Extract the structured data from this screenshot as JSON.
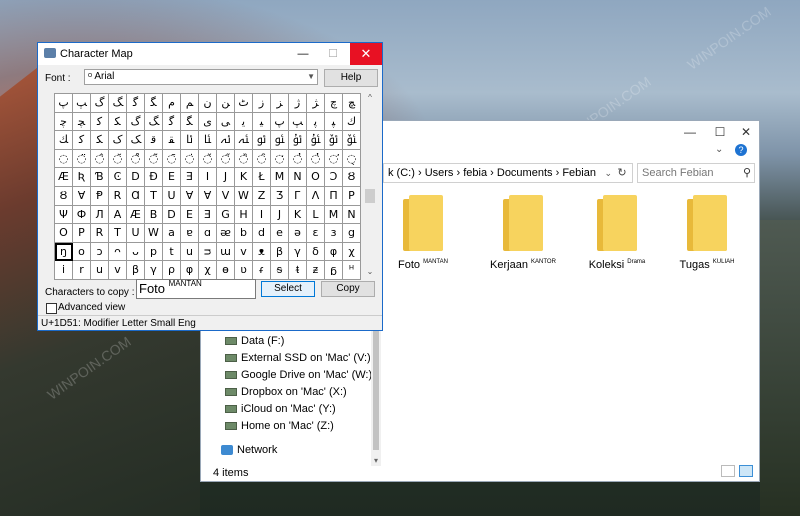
{
  "desktop": {
    "watermark": "WINPOIN.COM"
  },
  "explorer": {
    "address": {
      "segments": [
        "k (C:)",
        "Users",
        "febia",
        "Documents",
        "Febian"
      ],
      "separator": "›",
      "dropdown_icon": "chevron-down-icon",
      "refresh_icon": "refresh-icon"
    },
    "search_placeholder": "Search Febian",
    "window_buttons": [
      "—",
      "☐",
      "✕"
    ],
    "folders": [
      {
        "name": "Foto",
        "tag": "MANTAN"
      },
      {
        "name": "Kerjaan",
        "tag": "KANTOR"
      },
      {
        "name": "Koleksi",
        "tag": "Drama"
      },
      {
        "name": "Tugas",
        "tag": "KULIAH"
      }
    ],
    "nav_items": [
      {
        "label": "Data (F:)",
        "icon": "drive-icon"
      },
      {
        "label": "External SSD on 'Mac' (V:)",
        "icon": "drive-icon"
      },
      {
        "label": "Google Drive on 'Mac' (W:)",
        "icon": "drive-icon"
      },
      {
        "label": "Dropbox on 'Mac' (X:)",
        "icon": "drive-icon"
      },
      {
        "label": "iCloud on 'Mac' (Y:)",
        "icon": "drive-icon"
      },
      {
        "label": "Home on 'Mac' (Z:)",
        "icon": "drive-icon"
      }
    ],
    "network_label": "Network",
    "status": "4 items"
  },
  "charmap": {
    "title": "Character Map",
    "font_label": "Font :",
    "font_value": "Arial",
    "help_label": "Help",
    "grid_rows": [
      [
        "ﭖ",
        "ﭗ",
        "ﮒ",
        "ﮓ",
        "ﮔ",
        "ﮕ",
        "ﻡ",
        "ﻢ",
        "ﻥ",
        "ﻦ",
        "ﭦ",
        "ﺯ",
        "ﺰ",
        "ﮊ",
        "ﮋ",
        "ﭺ",
        "ﭻ"
      ],
      [
        "ﭼ",
        "ﭽ",
        "ﮐ",
        "ﮑ",
        "ﮒ",
        "ﮓ",
        "ﮔ",
        "ﮕ",
        "ﯼ",
        "ﯽ",
        "ﯾ",
        "ﯿ",
        "ﭖ",
        "ﭗ",
        "ﭘ",
        "ﭙ",
        "ﻙ"
      ],
      [
        "ﻚ",
        "ﻛ",
        "ﻜ",
        "ﮎ",
        "ﮏ",
        "ﻗ",
        "ﻘ",
        "ﯪ",
        "ﯫ",
        "ﯬ",
        "ﯭ",
        "ﯮ",
        "ﯯ",
        "ﯰ",
        "ﯱ",
        "ﯲ",
        "ﯳ"
      ],
      [
        "◌",
        "◌̈",
        "◌̂",
        "◌̆",
        "◌̊",
        "◌̃",
        "◌̄",
        "◌̇",
        "◌̌",
        "◌̋",
        "◌̏",
        "◌̑",
        "◌̒",
        "◌̓",
        "◌̔",
        "◌̕",
        "◌̖"
      ],
      [
        "Æ",
        "Ʀ",
        "Ɓ",
        "Ͼ",
        "D",
        "Ð",
        "E",
        "Ǝ",
        "I",
        "J",
        "K",
        "Ł",
        "M",
        "N",
        "O",
        "Ɔ",
        "Ȣ"
      ],
      [
        "Ȣ",
        "Ɐ",
        "Ᵽ",
        "R",
        "Ɑ",
        "T",
        "U",
        "Ɐ",
        "Ɐ",
        "V",
        "W",
        "Z",
        "Ʒ",
        "Г",
        "Λ",
        "Π",
        "Ρ"
      ],
      [
        "Ψ",
        "Ф",
        "Л",
        "A",
        "Æ",
        "B",
        "D",
        "E",
        "Ǝ",
        "G",
        "H",
        "I",
        "J",
        "K",
        "L",
        "M",
        "N"
      ],
      [
        "O",
        "P",
        "R",
        "T",
        "U",
        "W",
        "a",
        "ɐ",
        "ɑ",
        "ᴂ",
        "b",
        "d",
        "e",
        "ə",
        "ɛ",
        "ɜ",
        "g"
      ],
      [
        "ŋ",
        "o",
        "ɔ",
        "ᴖ",
        "ᴗ",
        "p",
        "t",
        "u",
        "ᴝ",
        "ɯ",
        "v",
        "ᴥ",
        "β",
        "γ",
        "δ",
        "φ",
        "χ"
      ],
      [
        "i",
        "r",
        "u",
        "v",
        "β",
        "γ",
        "ρ",
        "φ",
        "χ",
        "ɵ",
        "ʋ",
        "ᵳ",
        "ᵴ",
        "ᵵ",
        "ᵶ",
        "ᵷ",
        "ᵸ"
      ]
    ],
    "selected_cell": "8-0",
    "characters_to_copy_label": "Characters to copy :",
    "characters_to_copy_value": "Foto",
    "characters_to_copy_tag": "MANTAN",
    "select_label": "Select",
    "copy_label": "Copy",
    "advanced_view_label": "Advanced view",
    "status": "U+1D51: Modifier Letter Small Eng"
  }
}
